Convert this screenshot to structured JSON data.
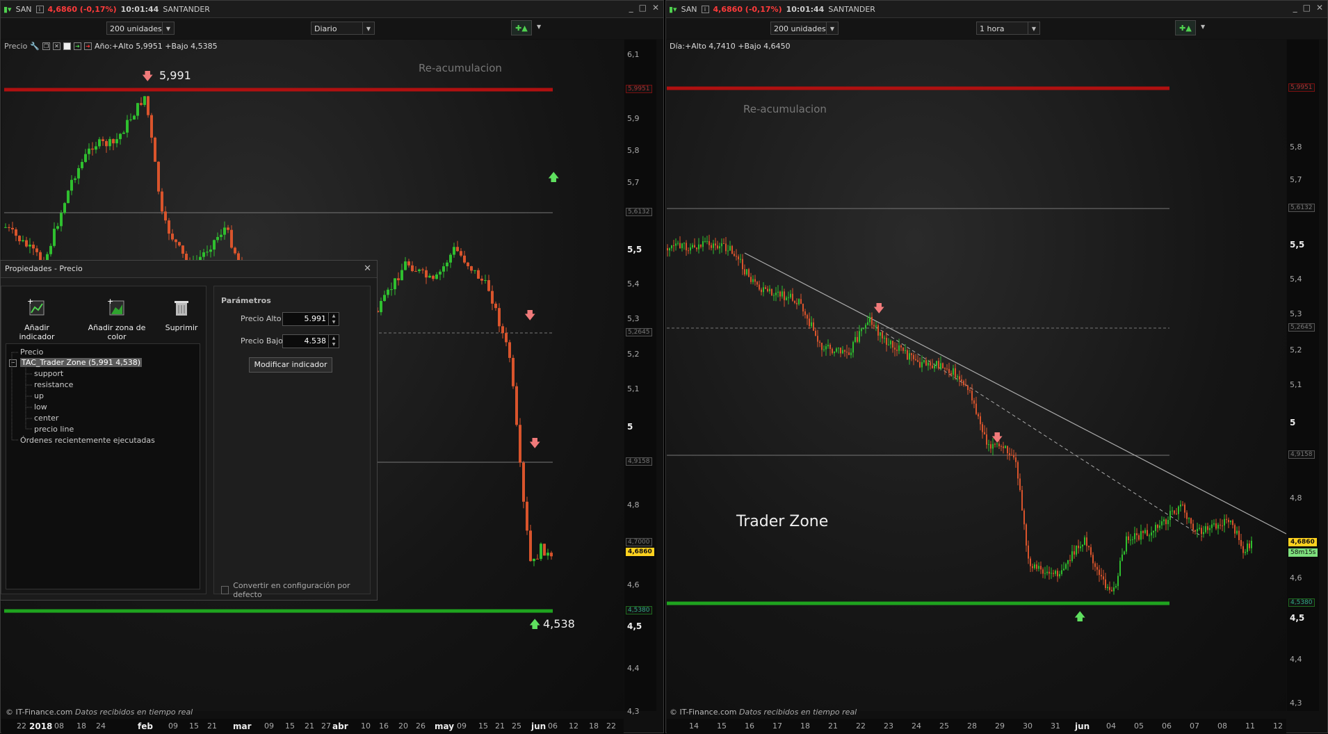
{
  "left_window": {
    "symbol": "SAN",
    "price_change": "4,6860 (-0,17%)",
    "time": "10:01:44",
    "name": "SANTANDER",
    "units": "200 unidades",
    "timeframe": "Diario",
    "price_label": "Precio",
    "range_info": "Año:+Alto 5,9951 +Bajo 4,5385",
    "annotation": "Re-acumulacion",
    "high_label": "5,991",
    "low_label": "4,538",
    "y_ticks": [
      "6,1",
      "5,9",
      "5,8",
      "5,7",
      "5,6",
      "5,5",
      "5,4",
      "5,3",
      "5,2",
      "5,1",
      "5",
      "4,9",
      "4,8",
      "4,7",
      "4,6",
      "4,5",
      "4,4",
      "4,3"
    ],
    "flags": {
      "red": "5,9951",
      "l1": "5,6132",
      "l2": "5,2645",
      "l3": "4,9158",
      "l4": "4,7000",
      "cur": "4,6860",
      "green": "4,5380"
    },
    "x_ticks": [
      "22",
      "2018",
      "08",
      "18",
      "24",
      "feb",
      "09",
      "15",
      "21",
      "mar",
      "09",
      "15",
      "21",
      "27",
      "abr",
      "10",
      "16",
      "20",
      "26",
      "may",
      "09",
      "15",
      "21",
      "25",
      "jun",
      "06",
      "12",
      "18",
      "22"
    ],
    "footer_copy": "© IT-Finance.com",
    "footer_status": "Datos recibidos en tiempo real"
  },
  "right_window": {
    "symbol": "SAN",
    "price_change": "4,6860 (-0,17%)",
    "time": "10:01:44",
    "name": "SANTANDER",
    "units": "200 unidades",
    "timeframe": "1 hora",
    "range_info": "Día:+Alto 4,7410 +Bajo 4,6450",
    "annotation": "Re-acumulacion",
    "big_label": "Trader Zone",
    "y_ticks": [
      "5,8",
      "5,7",
      "5,6",
      "5,5",
      "5,4",
      "5,3",
      "5,2",
      "5,1",
      "5",
      "4,9",
      "4,8",
      "4,7",
      "4,6",
      "4,5",
      "4,4",
      "4,3"
    ],
    "flags": {
      "red": "5,9951",
      "l1": "5,6132",
      "l2": "5,2645",
      "l3": "4,9158",
      "cur": "4,6860",
      "time": "58m15s",
      "green": "4,5380"
    },
    "x_ticks": [
      "14",
      "15",
      "16",
      "17",
      "18",
      "21",
      "22",
      "23",
      "24",
      "25",
      "28",
      "29",
      "30",
      "31",
      "jun",
      "04",
      "05",
      "06",
      "07",
      "08",
      "11",
      "12"
    ],
    "footer_copy": "© IT-Finance.com",
    "footer_status": "Datos recibidos en tiempo real"
  },
  "dialog": {
    "title": "Propiedades - Precio",
    "buttons": [
      "Añadir indicador",
      "Añadir zona de color",
      "Suprimir"
    ],
    "tree": {
      "root": "Precio",
      "indicator": "TAC_Trader Zone (5,991 4,538)",
      "children": [
        "support",
        "resistance",
        "up",
        "low",
        "center",
        "precio line"
      ],
      "orders": "Órdenes recientemente ejecutadas"
    },
    "params_header": "Parámetros",
    "precio_alto_label": "Precio Alto",
    "precio_alto_value": "5.991",
    "precio_bajo_label": "Precio Bajo",
    "precio_bajo_value": "4.538",
    "modify_button": "Modificar indicador",
    "default_checkbox": "Convertir en configuración por defecto"
  },
  "colors": {
    "resistance": "#b01010",
    "support": "#1fa31f",
    "bull": "#2fbf2f",
    "bear": "#d9542c",
    "current": "#ffd21f"
  }
}
